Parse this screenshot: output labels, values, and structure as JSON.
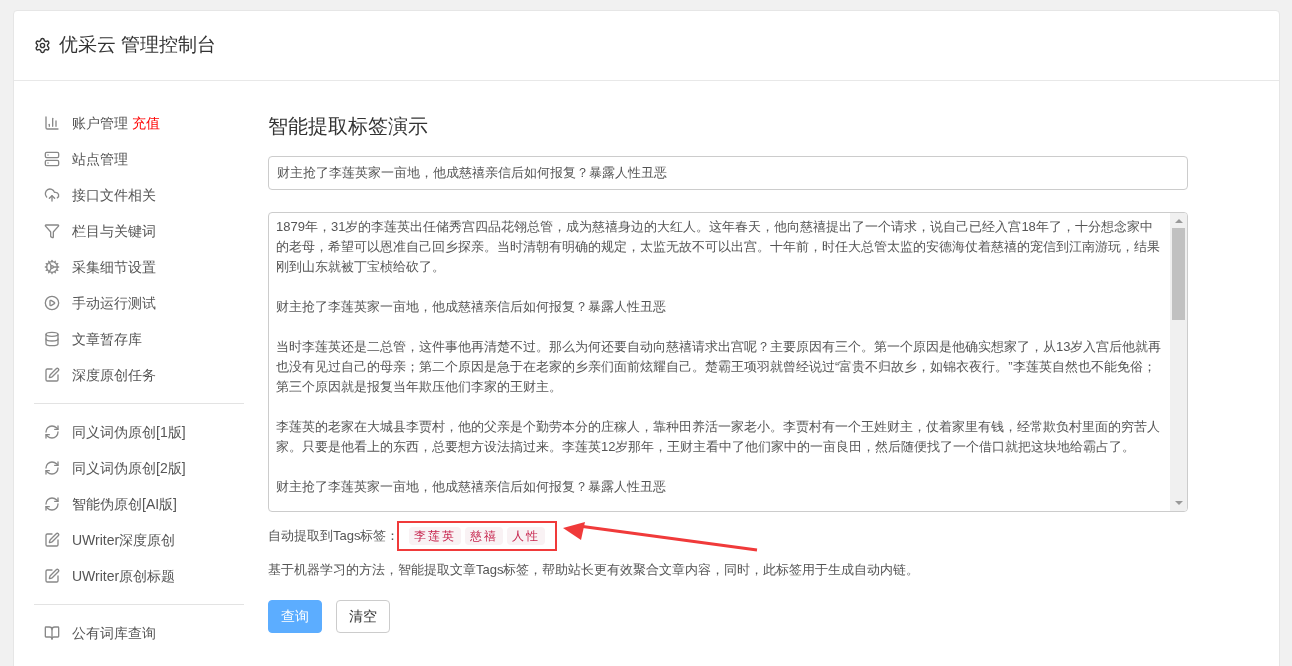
{
  "header": {
    "title": "优采云 管理控制台"
  },
  "sidebar": {
    "groups": [
      {
        "items": [
          {
            "label": "账户管理",
            "badge": "充值"
          },
          {
            "label": "站点管理"
          },
          {
            "label": "接口文件相关"
          },
          {
            "label": "栏目与关键词"
          },
          {
            "label": "采集细节设置"
          },
          {
            "label": "手动运行测试"
          },
          {
            "label": "文章暂存库"
          },
          {
            "label": "深度原创任务"
          }
        ]
      },
      {
        "items": [
          {
            "label": "同义词伪原创[1版]"
          },
          {
            "label": "同义词伪原创[2版]"
          },
          {
            "label": "智能伪原创[AI版]"
          },
          {
            "label": "UWriter深度原创"
          },
          {
            "label": "UWriter原创标题"
          }
        ]
      },
      {
        "items": [
          {
            "label": "公有词库查询"
          }
        ]
      }
    ]
  },
  "main": {
    "heading": "智能提取标签演示",
    "title_field": {
      "value": "财主抢了李莲英家一亩地，他成慈禧亲信后如何报复？暴露人性丑恶"
    },
    "content_field": {
      "paragraphs": [
        "1879年，31岁的李莲英出任储秀宫四品花翎总管，成为慈禧身边的大红人。这年春天，他向慈禧提出了一个请求，说自己已经入宫18年了，十分想念家中的老母，希望可以恩准自己回乡探亲。当时清朝有明确的规定，太监无故不可以出宫。十年前，时任大总管太监的安德海仗着慈禧的宠信到江南游玩，结果刚到山东就被丁宝桢给砍了。",
        "财主抢了李莲英家一亩地，他成慈禧亲信后如何报复？暴露人性丑恶",
        "当时李莲英还是二总管，这件事他再清楚不过。那么为何还要自动向慈禧请求出宫呢？主要原因有三个。第一个原因是他确实想家了，从13岁入宫后他就再也没有见过自己的母亲；第二个原因是急于在老家的乡亲们面前炫耀自己。楚霸王项羽就曾经说过“富贵不归故乡，如锦衣夜行。”李莲英自然也不能免俗；第三个原因就是报复当年欺压他们李家的王财主。",
        "李莲英的老家在大城县李贾村，他的父亲是个勤劳本分的庄稼人，靠种田养活一家老小。李贾村有一个王姓财主，仗着家里有钱，经常欺负村里面的穷苦人家。只要是他看上的东西，总要想方设法搞过来。李莲英12岁那年，王财主看中了他们家中的一亩良田，然后随便找了一个借口就把这块地给霸占了。",
        "财主抢了李莲英家一亩地，他成慈禧亲信后如何报复？暴露人性丑恶"
      ]
    },
    "tags_label": "自动提取到Tags标签：",
    "tags": [
      "李莲英",
      "慈禧",
      "人性"
    ],
    "description": "基于机器学习的方法，智能提取文章Tags标签，帮助站长更有效聚合文章内容，同时，此标签用于生成自动内链。",
    "buttons": [
      {
        "label": "查询",
        "kind": "primary"
      },
      {
        "label": "清空",
        "kind": "default"
      }
    ]
  }
}
